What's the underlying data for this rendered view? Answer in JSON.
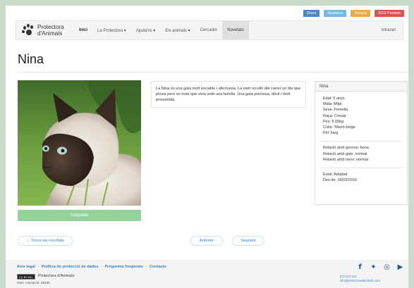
{
  "top_buttons": [
    {
      "label": "Dona",
      "color": "#4d86c8"
    },
    {
      "label": "Apadrina",
      "color": "#6dbbe4"
    },
    {
      "label": "Adopta",
      "color": "#eea93b"
    },
    {
      "label": "SOS Perduts",
      "color": "#d9534f"
    }
  ],
  "logo": {
    "line1": "Protectora",
    "line2": "d'Animals",
    "icon": "paw-icon"
  },
  "nav": {
    "items": [
      {
        "label": "Inici"
      },
      {
        "label": "La Protectora ▾"
      },
      {
        "label": "Ajuda'ns ▾"
      },
      {
        "label": "Els animals ▾"
      },
      {
        "label": "Cercador"
      },
      {
        "label": "Novetats"
      }
    ],
    "intranet": "Intranet"
  },
  "animal": {
    "name": "Nina",
    "status_label": "Adoptada",
    "description": "La Nina és una gata molt sociable i afectuosa. La vam recollir del carrer un dia que plovia però es nota que vivia amb una família. Una gata preciosa, dòcil i molt presumida."
  },
  "panel": {
    "title": "Nina",
    "basic": [
      "Edat: 5 anys",
      "Mida: Mitjà",
      "Sexe: Femella",
      "Raça: Creuat",
      "Pes: 5.00kg",
      "Color: Marró-beige",
      "Pèl: llarg"
    ],
    "relations": [
      "Relació amb gossos: bona",
      "Relació amb gats: normal",
      "Relació amb nens: normal"
    ],
    "state": [
      "Estat: Adoptat",
      "Des de: 16/03/2016"
    ]
  },
  "buttons": {
    "back": "← Torna als resultats",
    "prev": "Anterior",
    "next": "Següent"
  },
  "footer": {
    "links": [
      "Avís legal",
      "Política de protecció de dades",
      "Preguntes freqüents",
      "Contacte"
    ],
    "link_separator": "·",
    "cc_badge": "CC BY-NC-SA",
    "org": "Protectora d'Animals",
    "registration": "Núm. inscripció: 55485",
    "phone": "972 572 121",
    "email": "info@protectoradanimals.com",
    "socials": [
      "facebook-icon",
      "twitter-icon",
      "instagram-icon",
      "youtube-icon"
    ]
  }
}
